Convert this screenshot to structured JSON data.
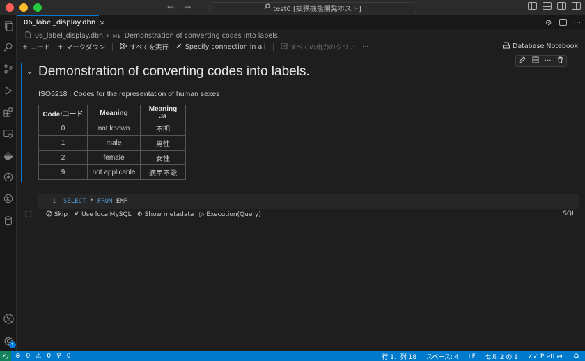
{
  "window": {
    "title": "test0 [拡張機能開発ホスト]"
  },
  "tab": {
    "filename": "06_label_display.dbn",
    "close_glyph": "×"
  },
  "breadcrumb": {
    "file": "06_label_display.dbn",
    "separator": "›",
    "md_marker": "M↓",
    "section": "Demonstration of converting codes into labels."
  },
  "toolbar": {
    "add_code": "コード",
    "add_markdown": "マークダウン",
    "run_all": "すべてを実行",
    "specify_connection": "Specify connection in all",
    "clear_outputs": "すべての出力のクリア",
    "more": "···",
    "notebook_kind": "Database Notebook"
  },
  "markdown_cell": {
    "title": "Demonstration of converting codes into labels.",
    "description": "ISO5218 : Codes for the representation of human sexes",
    "table": {
      "headers": [
        "Code:コード",
        "Meaning",
        "Meaning Ja"
      ],
      "rows": [
        [
          "0",
          "not known",
          "不明"
        ],
        [
          "1",
          "male",
          "男性"
        ],
        [
          "2",
          "female",
          "女性"
        ],
        [
          "9",
          "not applicable",
          "適用不能"
        ]
      ]
    }
  },
  "code_cell": {
    "line_number": "1",
    "keyword_select": "SELECT",
    "star": "*",
    "keyword_from": "FROM",
    "table_name": "EMP",
    "status": {
      "bracket": "[ ]",
      "skip": "Skip",
      "connection": "Use localMySQL",
      "metadata": "Show metadata",
      "execution": "Execution(Query)",
      "language": "SQL"
    }
  },
  "statusbar": {
    "errors": "0",
    "warnings": "0",
    "ports": "0",
    "position": "行 1、列 18",
    "spaces": "スペース: 4",
    "eol": "LF",
    "cell": "セル 2 の 1",
    "formatter": "Prettier"
  },
  "activity": {
    "accounts_badge": "1"
  },
  "colors": {
    "accent": "#0078d4",
    "statusbar": "#007acc",
    "background": "#1e1e1e"
  }
}
